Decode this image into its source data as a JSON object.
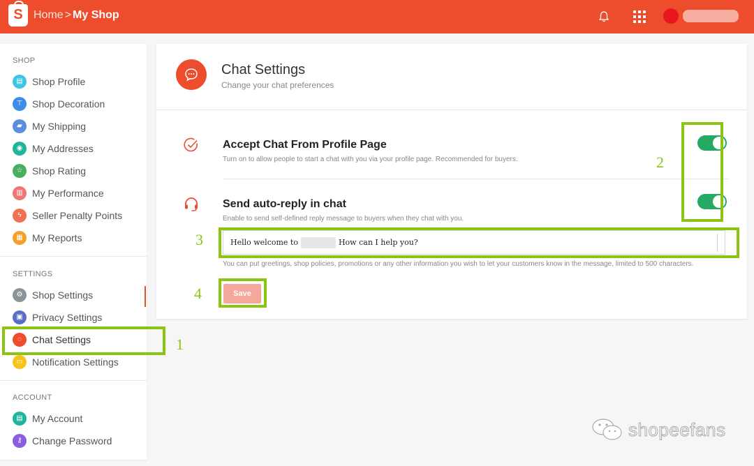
{
  "header": {
    "logo_letter": "S",
    "breadcrumb_home": "Home",
    "breadcrumb_sep": ">",
    "breadcrumb_current": "My Shop",
    "brand_color": "#ee4d2d"
  },
  "sidebar": {
    "shop_section": "SHOP",
    "shop_items": [
      {
        "label": "Shop Profile",
        "icon": "profile-icon",
        "color": "#3cc6e0"
      },
      {
        "label": "Shop Decoration",
        "icon": "paint-brush-icon",
        "color": "#3b8ee8"
      },
      {
        "label": "My Shipping",
        "icon": "truck-icon",
        "color": "#5b8ee0"
      },
      {
        "label": "My Addresses",
        "icon": "location-pin-icon",
        "color": "#1fb59a"
      },
      {
        "label": "Shop Rating",
        "icon": "star-icon",
        "color": "#48b05c"
      },
      {
        "label": "My Performance",
        "icon": "chart-icon",
        "color": "#f07575"
      },
      {
        "label": "Seller Penalty Points",
        "icon": "lightning-icon",
        "color": "#f07055"
      },
      {
        "label": "My Reports",
        "icon": "report-icon",
        "color": "#f4a12a"
      }
    ],
    "settings_section": "SETTINGS",
    "settings_items": [
      {
        "label": "Shop Settings",
        "icon": "gear-icon",
        "color": "#8a9499"
      },
      {
        "label": "Privacy Settings",
        "icon": "lock-icon",
        "color": "#5a6ec8"
      },
      {
        "label": "Chat Settings",
        "icon": "chat-icon",
        "color": "#ee4d2d"
      },
      {
        "label": "Notification Settings",
        "icon": "notification-icon",
        "color": "#f7c21a"
      }
    ],
    "account_section": "ACCOUNT",
    "account_items": [
      {
        "label": "My Account",
        "icon": "id-card-icon",
        "color": "#1fb59a"
      },
      {
        "label": "Change Password",
        "icon": "key-icon",
        "color": "#8a5ee0"
      }
    ]
  },
  "main": {
    "title": "Chat Settings",
    "subtitle": "Change your chat preferences",
    "accept_chat": {
      "title": "Accept Chat From Profile Page",
      "description": "Turn on to allow people to start a chat with you via your profile page. Recommended for buyers.",
      "enabled": true
    },
    "auto_reply": {
      "title": "Send auto-reply in chat",
      "description": "Enable to send self-defined reply message to buyers when they chat with you.",
      "enabled": true,
      "message_prefix": "Hello welcome to",
      "message_suffix": "How can I help you?",
      "hint": "You can put greetings, shop policies, promotions or any other information you wish to let your customers know in the message, limited to 500 characters."
    },
    "save_label": "Save",
    "toggle_color": "#26aa63"
  },
  "annotations": {
    "n1": "1",
    "n2": "2",
    "n3": "3",
    "n4": "4",
    "color": "#8cc414"
  },
  "watermark": "shopeefans"
}
